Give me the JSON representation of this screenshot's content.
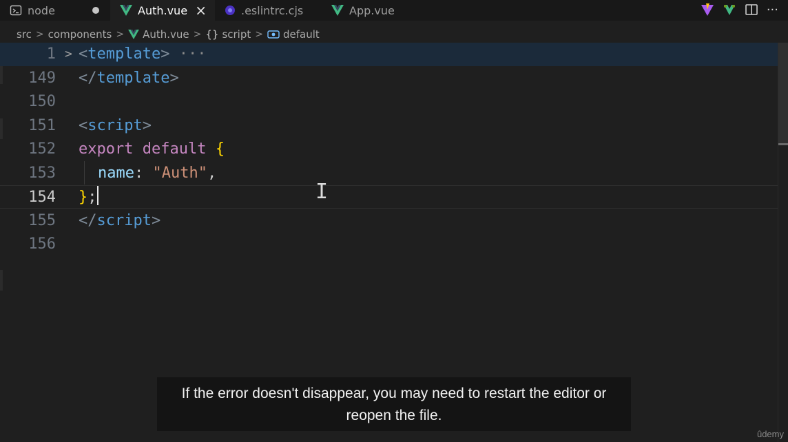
{
  "tabs": [
    {
      "label": "node",
      "icon": "terminal-icon"
    },
    {
      "label": "Auth.vue",
      "icon": "vue-icon",
      "close": "×"
    },
    {
      "label": ".eslintrc.cjs",
      "icon": "eslint-icon"
    },
    {
      "label": "App.vue",
      "icon": "vue-icon"
    }
  ],
  "tab_actions": {
    "more": "···"
  },
  "breadcrumb": {
    "items": [
      "src",
      "components",
      "Auth.vue",
      "script",
      "default"
    ],
    "sep": ">",
    "braces": "{}"
  },
  "editor": {
    "line_numbers": [
      "1",
      "149",
      "150",
      "151",
      "152",
      "153",
      "154",
      "155",
      "156"
    ],
    "folded_marker": "···",
    "code": {
      "l1_open": "<",
      "l1_tag": "template",
      "l1_close": ">",
      "l149_open": "</",
      "l149_tag": "template",
      "l149_close": ">",
      "l151_open": "<",
      "l151_tag": "script",
      "l151_close": ">",
      "l152_export": "export",
      "l152_default": "default",
      "l152_brace": "{",
      "l153_prop": "name",
      "l153_colon": ":",
      "l153_str": "\"Auth\"",
      "l153_comma": ",",
      "l154_brace": "}",
      "l154_semi": ";",
      "l155_open": "</",
      "l155_tag": "script",
      "l155_close": ">"
    }
  },
  "subtitle": {
    "line1": "If the error doesn't disappear, you may need to restart the editor or",
    "line2": "reopen the file."
  },
  "watermark": "ûdemy",
  "colors": {
    "vue_green": "#41b883",
    "eslint_purple": "#4b32c3",
    "tag_blue": "#569cd6",
    "keyword_purple": "#c586c0",
    "brace_gold": "#ffd700",
    "string_orange": "#ce9178",
    "property_lightblue": "#9cdcfe"
  }
}
